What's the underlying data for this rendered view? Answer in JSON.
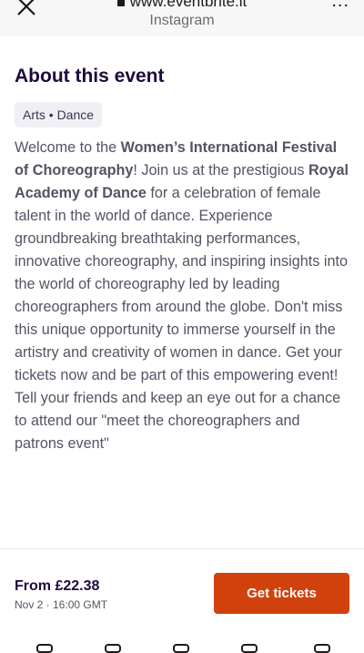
{
  "browser": {
    "url": "www.eventbrite.it",
    "source": "Instagram",
    "more": "..."
  },
  "about": {
    "title": "About this event",
    "tag": "Arts • Dance",
    "desc": {
      "p1": "Welcome to the ",
      "b1": "Women’s International Festival of Choreography",
      "p2": "! Join us at the prestigious ",
      "b2": "Royal Academy of Dance",
      "p3": " for a celebration of female talent in the world of dance. Experience groundbreaking breathtaking performances, innovative choreography, and inspiring insights into the world of choreography led by leading choreographers from around the globe. Don't miss this unique opportunity to immerse yourself in the artistry and creativity of women in dance. Get your tickets now and be part of this empowering event! Tell your friends and keep an eye out for a chance to attend our \"meet the choreographers and patrons event\""
    }
  },
  "footer": {
    "price": "From £22.38",
    "date": "Nov 2 · 16:00 GMT",
    "cta": "Get tickets"
  },
  "colors": {
    "accent": "#d1410c",
    "title": "#1e0a3c"
  }
}
